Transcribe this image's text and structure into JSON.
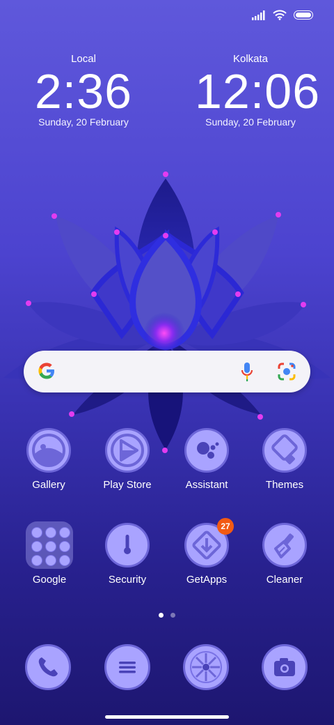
{
  "clocks": {
    "local": {
      "label": "Local",
      "time": "2:36",
      "date": "Sunday, 20 February"
    },
    "kolkata": {
      "label": "Kolkata",
      "time": "12:06",
      "date": "Sunday, 20 February"
    }
  },
  "search": {
    "engine_icon": "google-g-icon",
    "mic_icon": "mic-icon",
    "lens_icon": "lens-icon"
  },
  "apps_row1": [
    {
      "label": "Gallery",
      "icon": "gallery-icon"
    },
    {
      "label": "Play Store",
      "icon": "play-store-icon"
    },
    {
      "label": "Assistant",
      "icon": "assistant-icon"
    },
    {
      "label": "Themes",
      "icon": "themes-icon"
    }
  ],
  "apps_row2": [
    {
      "label": "Google",
      "icon": "folder-icon"
    },
    {
      "label": "Security",
      "icon": "security-icon"
    },
    {
      "label": "GetApps",
      "icon": "getapps-icon",
      "badge": "27"
    },
    {
      "label": "Cleaner",
      "icon": "cleaner-icon"
    }
  ],
  "dock": [
    "phone-icon",
    "messages-icon",
    "browser-icon",
    "camera-icon"
  ],
  "pages": {
    "count": 2,
    "active": 1
  },
  "colors": {
    "icon_fill": "#a9a3ff",
    "icon_border": "#6d66d8",
    "badge": "#f25a13",
    "accent_glow": "#e23cf0"
  }
}
